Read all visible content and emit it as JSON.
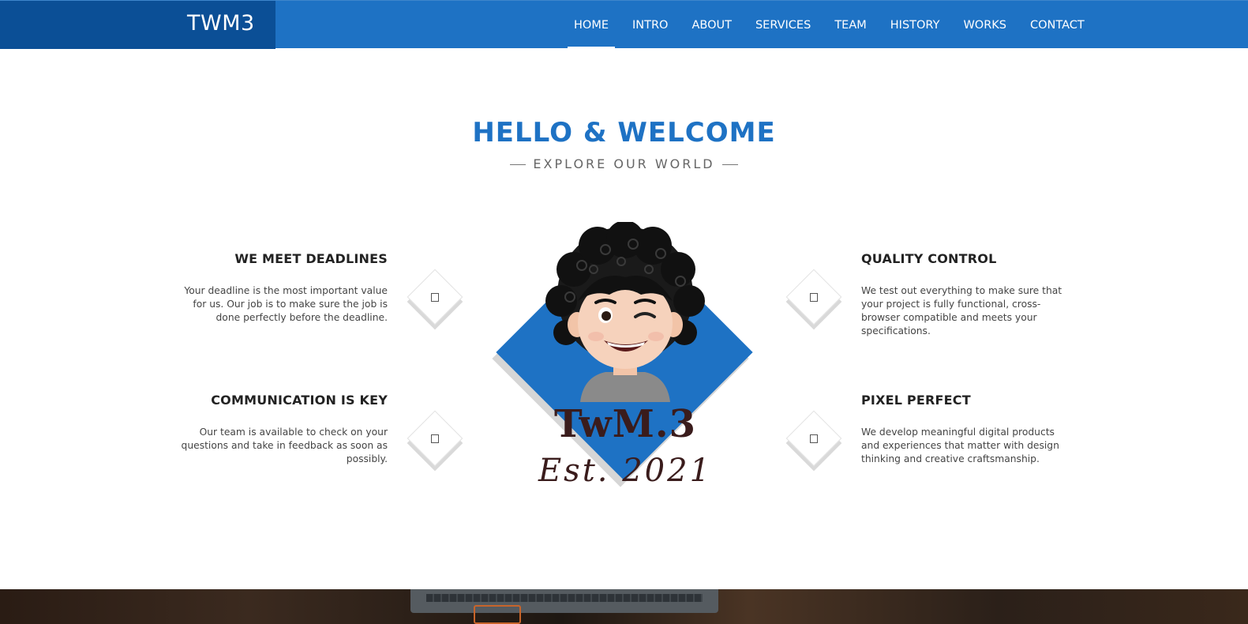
{
  "header": {
    "brand": "TWM3",
    "nav": [
      {
        "label": "HOME",
        "active": true
      },
      {
        "label": "INTRO",
        "active": false
      },
      {
        "label": "ABOUT",
        "active": false
      },
      {
        "label": "SERVICES",
        "active": false
      },
      {
        "label": "TEAM",
        "active": false
      },
      {
        "label": "HISTORY",
        "active": false
      },
      {
        "label": "WORKS",
        "active": false
      },
      {
        "label": "CONTACT",
        "active": false
      }
    ],
    "colors": {
      "bar": "#1e72c4",
      "brand_bg": "#0b4f96"
    }
  },
  "hero": {
    "title": "HELLO & WELCOME",
    "subtitle": "EXPLORE OUR WORLD"
  },
  "features": [
    {
      "title": "WE MEET DEADLINES",
      "text": "Your deadline is the most important value for us. Our job is to make sure the job is done perfectly before the deadline.",
      "icon": "clock-icon"
    },
    {
      "title": "COMMUNICATION IS KEY",
      "text": "Our team is available to check on your questions and take in feedback as soon as possibly.",
      "icon": "chat-icon"
    },
    {
      "title": "QUALITY CONTROL",
      "text": "We test out everything to make sure that your project is fully functional, cross-browser compatible and meets your specifications.",
      "icon": "check-icon"
    },
    {
      "title": "PIXEL PERFECT",
      "text": "We develop meaningful digital products and experiences that matter with design thinking and creative craftsmanship.",
      "icon": "pencil-icon"
    }
  ],
  "emblem": {
    "name": "TwM.3",
    "established": "Est. 2021",
    "accent": "#1e72c4"
  }
}
